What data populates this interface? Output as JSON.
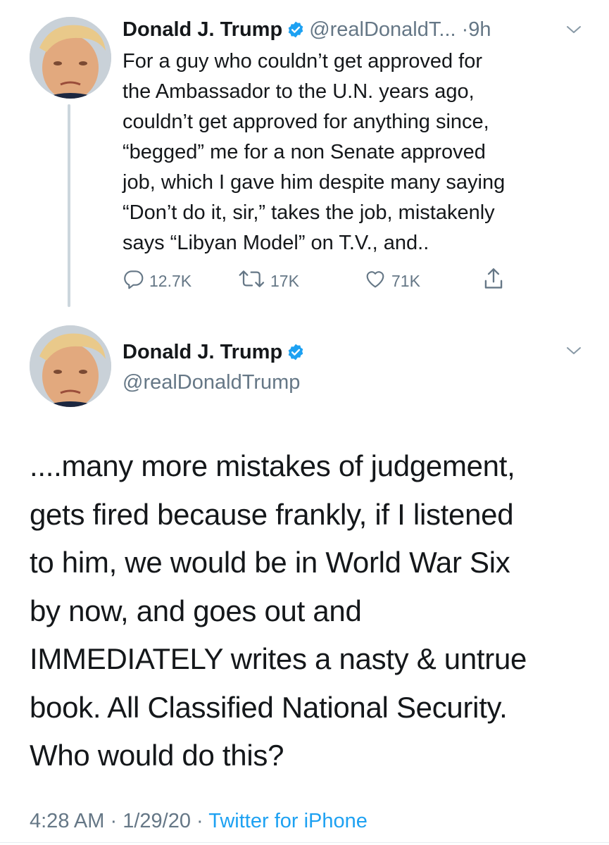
{
  "colors": {
    "text": "#14171a",
    "secondary": "#657786",
    "link": "#1da1f2",
    "verified": "#1da1f2",
    "thread_line": "#ccd6dd"
  },
  "tweet1": {
    "name": "Donald J. Trump",
    "verified_icon": "verified-badge-icon",
    "handle": "@realDonaldT...",
    "separator": "·",
    "time": "9h",
    "menu_icon": "chevron-down-icon",
    "text": "For a guy who couldn’t get approved for\nthe Ambassador to the U.N. years ago,\ncouldn’t get approved for anything since,\n“begged” me for a non Senate approved\njob, which I gave him despite many saying\n“Don’t do it, sir,” takes the job, mistakenly\nsays “Libyan Model” on T.V., and..",
    "actions": {
      "reply": {
        "icon": "reply-icon",
        "count": "12.7K"
      },
      "retweet": {
        "icon": "retweet-icon",
        "count": "17K"
      },
      "like": {
        "icon": "heart-icon",
        "count": "71K"
      },
      "share": {
        "icon": "share-icon"
      }
    }
  },
  "tweet2": {
    "name": "Donald J. Trump",
    "verified_icon": "verified-badge-icon",
    "handle": "@realDonaldTrump",
    "menu_icon": "chevron-down-icon",
    "text": "....many more mistakes of judgement,\ngets fired because frankly, if I listened\nto him, we would be in World War Six\nby now, and goes out and\nIMMEDIATELY writes a nasty & untrue\nbook. All Classified National Security.\nWho would do this?",
    "time": "4:28 AM",
    "sep1": "·",
    "date": "1/29/20",
    "sep2": "·",
    "source": "Twitter for iPhone"
  }
}
